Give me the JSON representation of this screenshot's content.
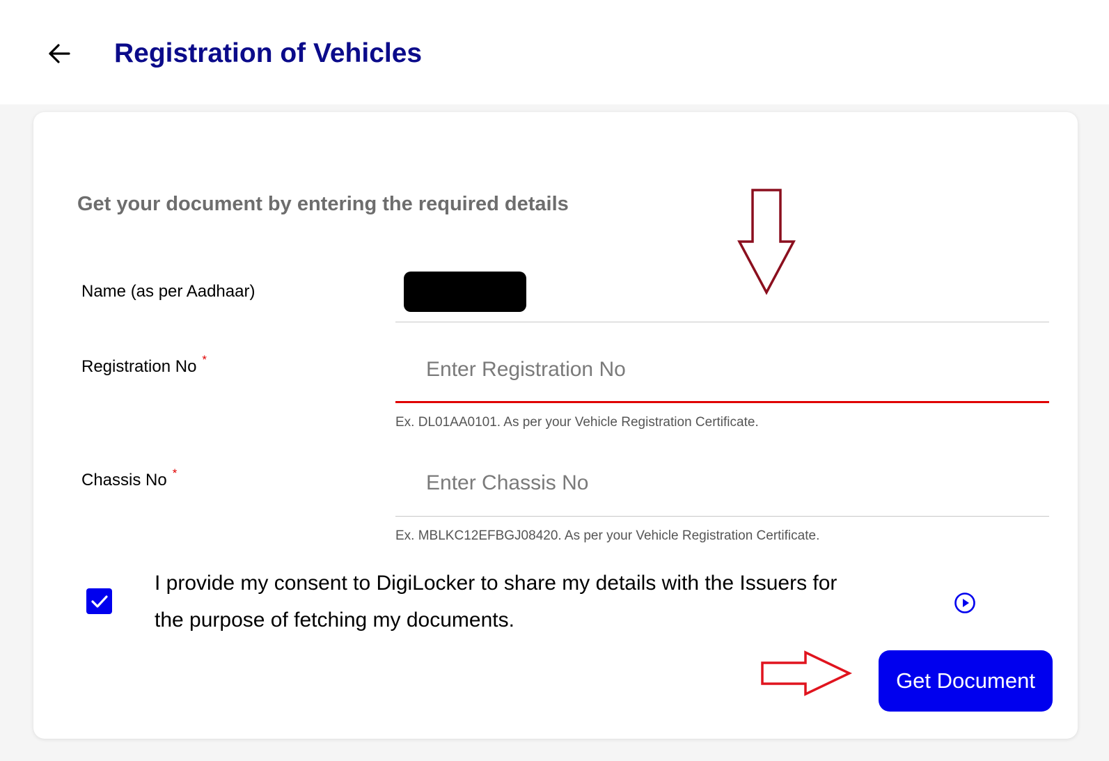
{
  "header": {
    "back_icon": "arrow-left-icon",
    "title": "Registration of Vehicles"
  },
  "form": {
    "subtitle": "Get your document by entering the required details",
    "name_field": {
      "label": "Name (as per Aadhaar)",
      "value_redacted": true
    },
    "registration_field": {
      "label": "Registration No",
      "required_mark": "*",
      "value": "",
      "placeholder": "Enter Registration No",
      "hint": "Ex. DL01AA0101. As per your Vehicle Registration Certificate.",
      "state": "error"
    },
    "chassis_field": {
      "label": "Chassis No",
      "required_mark": "*",
      "value": "",
      "placeholder": "Enter Chassis No",
      "hint": "Ex. MBLKC12EFBGJ08420. As per your Vehicle Registration Certificate."
    },
    "consent": {
      "checked": true,
      "text": "I provide my consent to DigiLocker to share my details with the Issuers for the purpose of fetching my documents.",
      "play_icon": "play-circle-icon"
    },
    "submit_label": "Get Document"
  },
  "colors": {
    "title": "#0b0b8a",
    "subtitle": "#6d6d6d",
    "primary": "#0000ee",
    "error": "#e00000",
    "annotation_down_arrow": "#8b0f1e",
    "annotation_right_arrow": "#e0141e"
  }
}
